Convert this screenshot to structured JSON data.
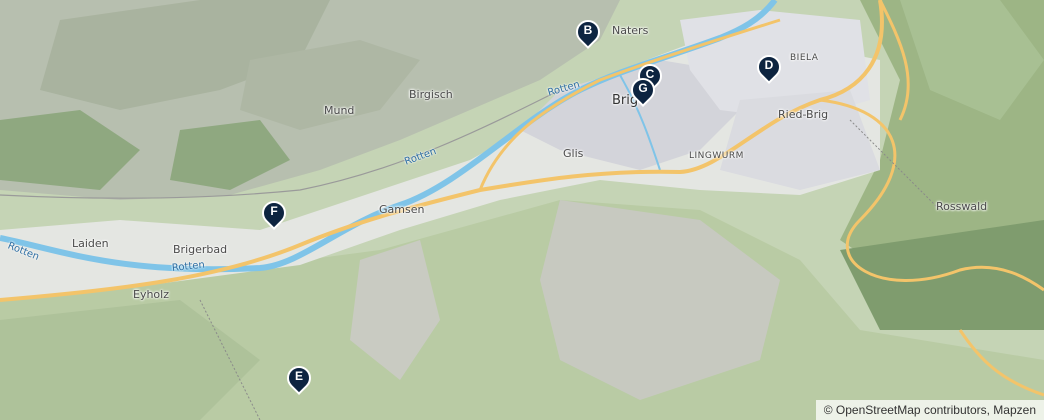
{
  "map": {
    "labels": {
      "naters": "Naters",
      "biela": "BIELA",
      "birgisch": "Birgisch",
      "mund": "Mund",
      "brig": "Brig",
      "ried_brig": "Ried-Brig",
      "glis": "Glis",
      "lingwurm": "LINGWURM",
      "gamsen": "Gamsen",
      "rosswald": "Rosswald",
      "laiden": "Laiden",
      "brigerbad": "Brigerbad",
      "eyholz": "Eyholz"
    },
    "rivers": {
      "rotten_1": "Rotten",
      "rotten_2": "Rotten",
      "rotten_3": "Rotten",
      "rotten_4": "Rotten"
    },
    "markers": [
      {
        "letter": "B"
      },
      {
        "letter": "C"
      },
      {
        "letter": "G"
      },
      {
        "letter": "D"
      },
      {
        "letter": "F"
      },
      {
        "letter": "E"
      }
    ],
    "attribution": "© OpenStreetMap contributors, Mapzen",
    "colors": {
      "marker": "#0d2440",
      "river": "#7fc4e8",
      "road": "#f3c46a",
      "urban": "#dcdce0",
      "forest": "#9fb58a"
    }
  }
}
